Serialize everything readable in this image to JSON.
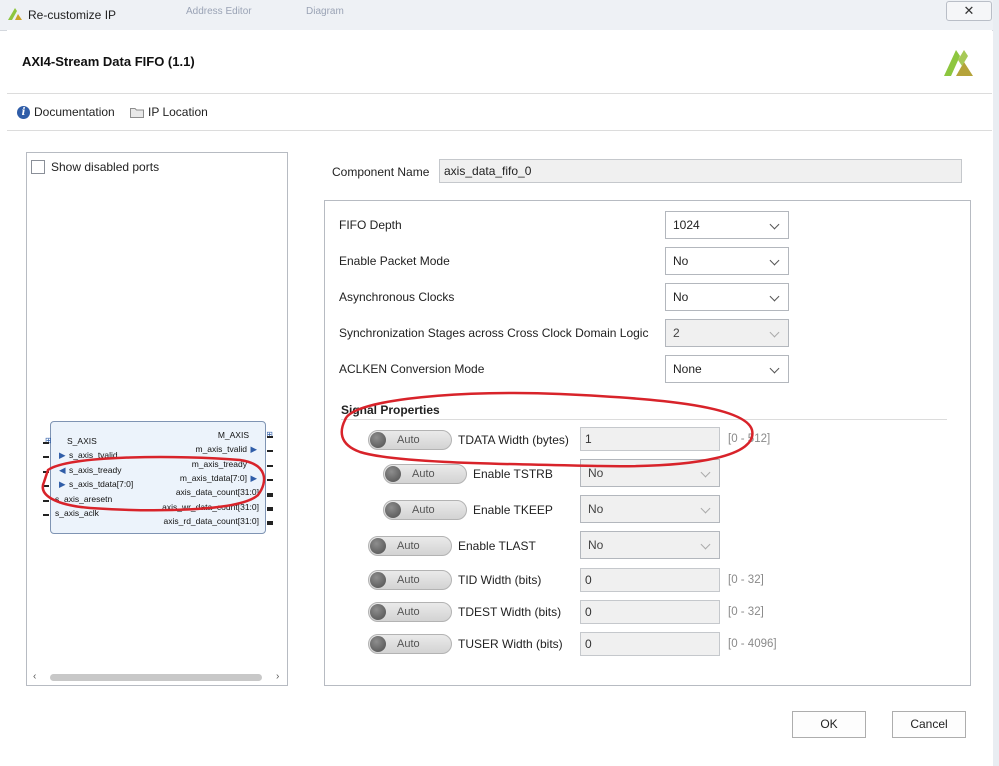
{
  "window": {
    "title": "Re-customize IP",
    "close_glyph": "✕",
    "ghost_tabs": [
      "Address Editor",
      "Diagram"
    ]
  },
  "header": {
    "title": "AXI4-Stream Data FIFO (1.1)",
    "logo_icon": "xilinx-logo-icon"
  },
  "toolbar": {
    "documentation": "Documentation",
    "ip_location": "IP Location"
  },
  "diagram": {
    "show_disabled_label": "Show disabled ports",
    "slave_bus": "S_AXIS",
    "master_bus": "M_AXIS",
    "left_ports": [
      "s_axis_tvalid",
      "s_axis_tready",
      "s_axis_tdata[7:0]",
      "s_axis_aresetn",
      "s_axis_aclk"
    ],
    "right_ports": [
      "m_axis_tvalid",
      "m_axis_tready",
      "m_axis_tdata[7:0]",
      "axis_data_count[31:0]",
      "axis_wr_data_count[31:0]",
      "axis_rd_data_count[31:0]"
    ]
  },
  "component": {
    "label": "Component Name",
    "value": "axis_data_fifo_0"
  },
  "params": [
    {
      "label": "FIFO Depth",
      "value": "1024",
      "enabled": true
    },
    {
      "label": "Enable Packet Mode",
      "value": "No",
      "enabled": true
    },
    {
      "label": "Asynchronous Clocks",
      "value": "No",
      "enabled": true
    },
    {
      "label": "Synchronization Stages across Cross Clock Domain Logic",
      "value": "2",
      "enabled": false
    },
    {
      "label": "ACLKEN Conversion Mode",
      "value": "None",
      "enabled": true
    }
  ],
  "signal_properties": {
    "title": "Signal Properties",
    "auto_label": "Auto",
    "rows": [
      {
        "label": "TDATA Width (bytes)",
        "value": "1",
        "range": "[0 - 512]",
        "kind": "text"
      },
      {
        "label": "Enable TSTRB",
        "value": "No",
        "kind": "select"
      },
      {
        "label": "Enable TKEEP",
        "value": "No",
        "kind": "select"
      },
      {
        "label": "Enable TLAST",
        "value": "No",
        "kind": "select"
      },
      {
        "label": "TID Width (bits)",
        "value": "0",
        "range": "[0 - 32]",
        "kind": "text"
      },
      {
        "label": "TDEST Width (bits)",
        "value": "0",
        "range": "[0 - 32]",
        "kind": "text"
      },
      {
        "label": "TUSER Width (bits)",
        "value": "0",
        "range": "[0 - 4096]",
        "kind": "text"
      }
    ]
  },
  "buttons": {
    "ok": "OK",
    "cancel": "Cancel"
  },
  "colors": {
    "annotation": "#d8232a",
    "accent": "#2f5da8",
    "logo_green": "#8dc63f"
  }
}
